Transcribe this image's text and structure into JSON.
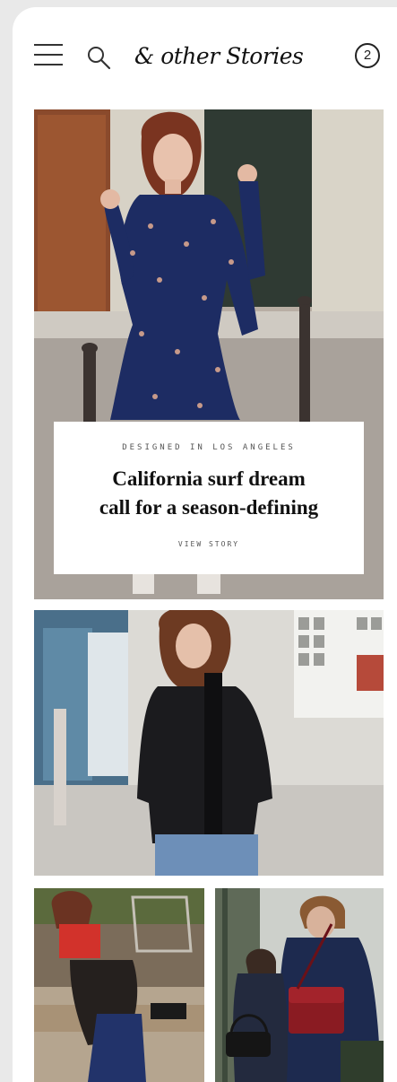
{
  "header": {
    "logo_text": "& other Stories",
    "bag_count": "2",
    "menu_icon": "hamburger-menu-icon",
    "search_icon": "search-icon"
  },
  "hero": {
    "eyebrow": "DESIGNED IN LOS ANGELES",
    "headline_line1": "California surf dream",
    "headline_line2": "call for a season-defining",
    "cta": "VIEW STORY"
  },
  "colors": {
    "text": "#111111",
    "background": "#ffffff",
    "page_background": "#e9e9e9"
  }
}
